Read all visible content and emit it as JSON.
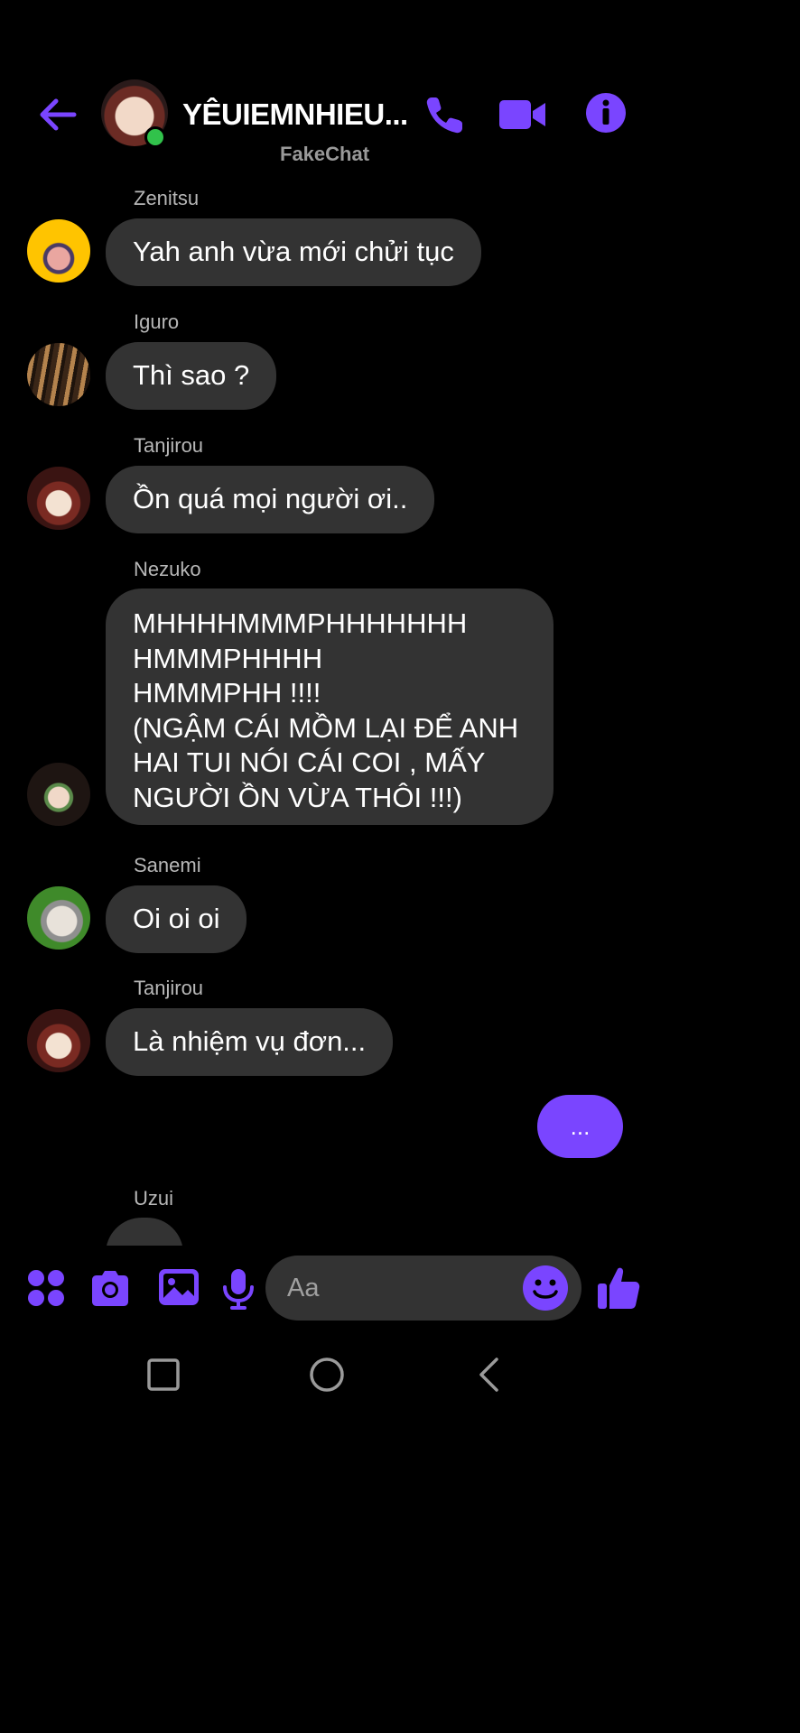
{
  "header": {
    "title": "YÊUIEMNHIEU...",
    "subtitle": "FakeChat",
    "online": true,
    "icons": [
      "back-arrow-icon",
      "phone-icon",
      "video-camera-icon",
      "info-icon"
    ]
  },
  "messages": [
    {
      "sender": "Zenitsu",
      "text": "Yah anh vừa mới chửi tục"
    },
    {
      "sender": "Iguro",
      "text": "Thì sao ?"
    },
    {
      "sender": "Tanjirou",
      "text": "Ồn quá mọi người ơi.."
    },
    {
      "sender": "Nezuko",
      "lines": [
        "MHHHHMMMPHHHHHHH",
        "HMMMPHHHH",
        "HMMMPHH !!!!",
        "(NGẬM CÁI MỒM LẠI ĐỂ ANH",
        "HAI TUI NÓI CÁI COI , MẤY",
        "NGƯỜI ỒN VỪA THÔI !!!)"
      ]
    },
    {
      "sender": "Sanemi",
      "text": "Oi oi oi"
    },
    {
      "sender": "Tanjirou",
      "text": "Là nhiệm vụ đơn..."
    },
    {
      "sender": "Uzui",
      "text": ""
    }
  ],
  "outgoing_typing": "...",
  "composer": {
    "placeholder": "Aa",
    "icons": [
      "apps-grid-icon",
      "camera-icon",
      "image-icon",
      "microphone-icon",
      "emoji-icon",
      "thumbs-up-icon"
    ]
  },
  "colors": {
    "accent": "#7a45ff",
    "bubble": "#333333",
    "background": "#000000",
    "online": "#31c24b"
  }
}
